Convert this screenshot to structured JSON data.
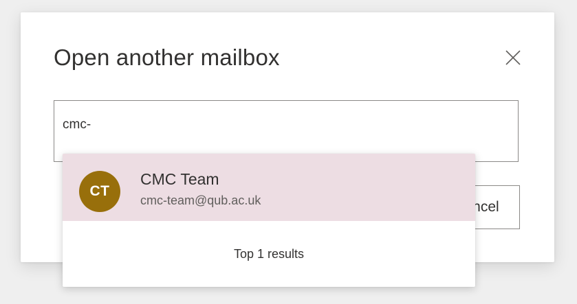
{
  "dialog": {
    "title": "Open another mailbox",
    "close_icon": "close-icon",
    "search": {
      "value": "cmc-",
      "placeholder": ""
    },
    "cancel_label": "Cancel"
  },
  "suggestions": {
    "items": [
      {
        "initials": "CT",
        "name": "CMC Team",
        "email": "cmc-team@qub.ac.uk",
        "avatar_color": "#986f0b",
        "highlight_color": "#eddde3"
      }
    ],
    "footer": "Top 1 results"
  }
}
